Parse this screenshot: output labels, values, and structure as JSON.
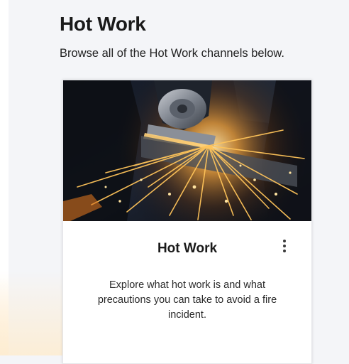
{
  "page": {
    "title": "Hot Work",
    "subtitle": "Browse all of the Hot Work channels below."
  },
  "card": {
    "image_alt": "angle grinder sparks",
    "title": "Hot Work",
    "description": "Explore what hot work is and what precautions you can take to avoid a fire incident.",
    "menu_icon": "more-vertical-icon"
  }
}
